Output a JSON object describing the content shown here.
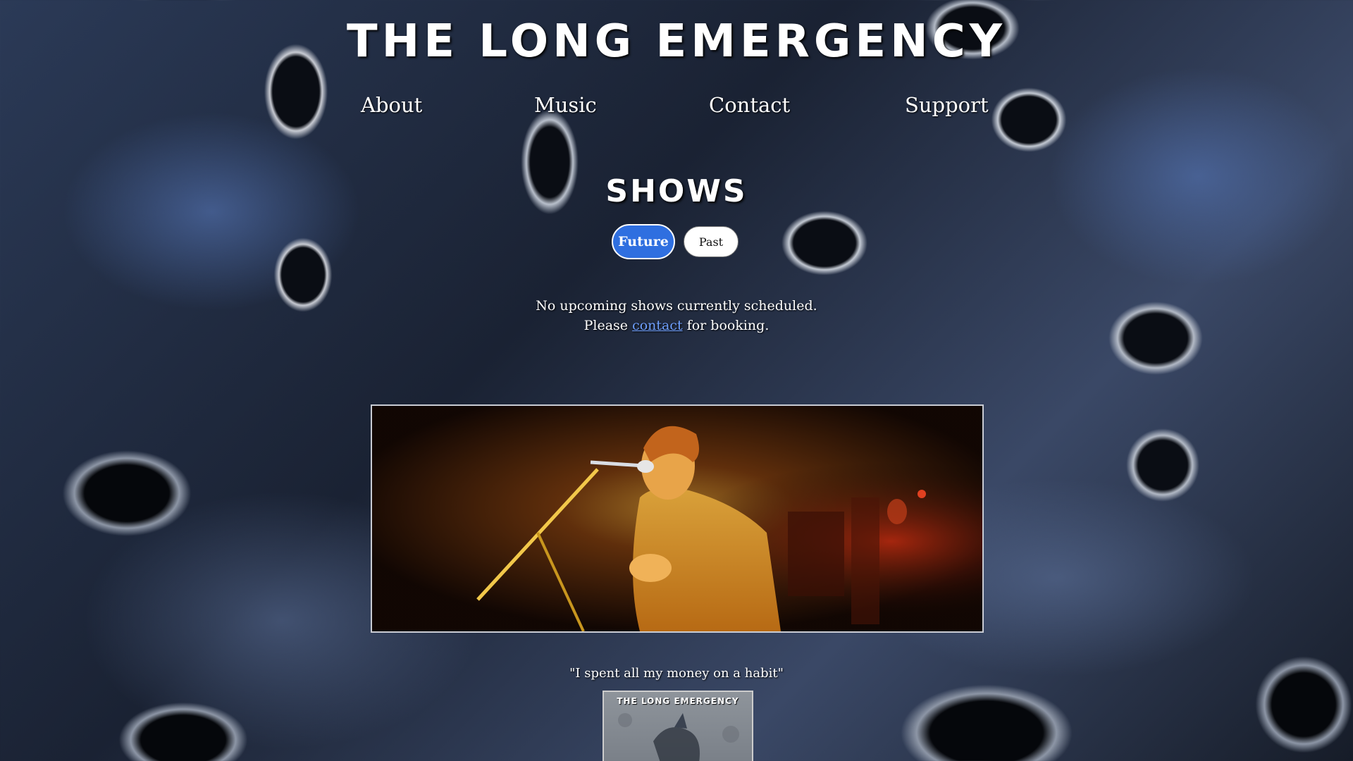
{
  "site": {
    "title": "THE LONG EMERGENCY"
  },
  "nav": {
    "items": [
      {
        "label": "About"
      },
      {
        "label": "Music"
      },
      {
        "label": "Contact"
      },
      {
        "label": "Support"
      }
    ]
  },
  "shows": {
    "title": "SHOWS",
    "toggle": {
      "future_label": "Future",
      "past_label": "Past",
      "selected": "Future"
    },
    "notice_line1": "No upcoming shows currently scheduled.",
    "notice_prefix": "Please ",
    "notice_link": "contact",
    "notice_suffix": " for booking."
  },
  "featured": {
    "quote": "\"I spent all my money on a habit\"",
    "album_title": "THE LONG EMERGENCY"
  },
  "colors": {
    "accent": "#2f6fe0",
    "link": "#6fa0ff",
    "text": "#ffffff"
  }
}
